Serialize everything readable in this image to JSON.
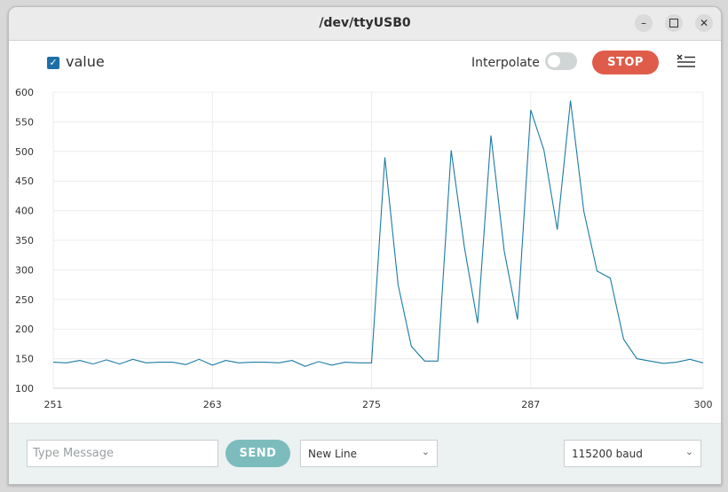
{
  "window": {
    "title": "/dev/ttyUSB0"
  },
  "toolbar": {
    "legend_label": "value",
    "legend_checked": true,
    "interpolate_label": "Interpolate",
    "interpolate_on": false,
    "stop_label": "STOP"
  },
  "bottom": {
    "message_placeholder": "Type Message",
    "send_label": "SEND",
    "line_ending": "New Line",
    "baud_rate": "115200 baud"
  },
  "colors": {
    "line": "#1b7aa6",
    "stop": "#e05c4a",
    "send": "#7cbcbc",
    "checkbox": "#1d6fa8"
  },
  "chart_data": {
    "type": "line",
    "x_ticks": [
      251,
      263,
      275,
      287,
      300
    ],
    "y_ticks": [
      100,
      150,
      200,
      250,
      300,
      350,
      400,
      450,
      500,
      550,
      600
    ],
    "xlim": [
      251,
      300
    ],
    "ylim": [
      100,
      600
    ],
    "grid": true,
    "series": [
      {
        "name": "value",
        "x": [
          251,
          252,
          253,
          254,
          255,
          256,
          257,
          258,
          259,
          260,
          261,
          262,
          263,
          264,
          265,
          266,
          267,
          268,
          269,
          270,
          271,
          272,
          273,
          274,
          275,
          276,
          277,
          278,
          279,
          280,
          281,
          282,
          283,
          284,
          285,
          286,
          287,
          288,
          289,
          290,
          291,
          292,
          293,
          294,
          295,
          296,
          297,
          298,
          299,
          300
        ],
        "values": [
          144,
          143,
          147,
          141,
          148,
          141,
          149,
          143,
          144,
          144,
          140,
          149,
          139,
          147,
          143,
          144,
          144,
          143,
          147,
          137,
          145,
          139,
          144,
          143,
          143,
          490,
          275,
          171,
          146,
          146,
          502,
          338,
          210,
          527,
          332,
          216,
          570,
          502,
          368,
          586,
          399,
          298,
          286,
          183,
          150,
          146,
          142,
          144,
          149,
          143
        ]
      }
    ]
  }
}
